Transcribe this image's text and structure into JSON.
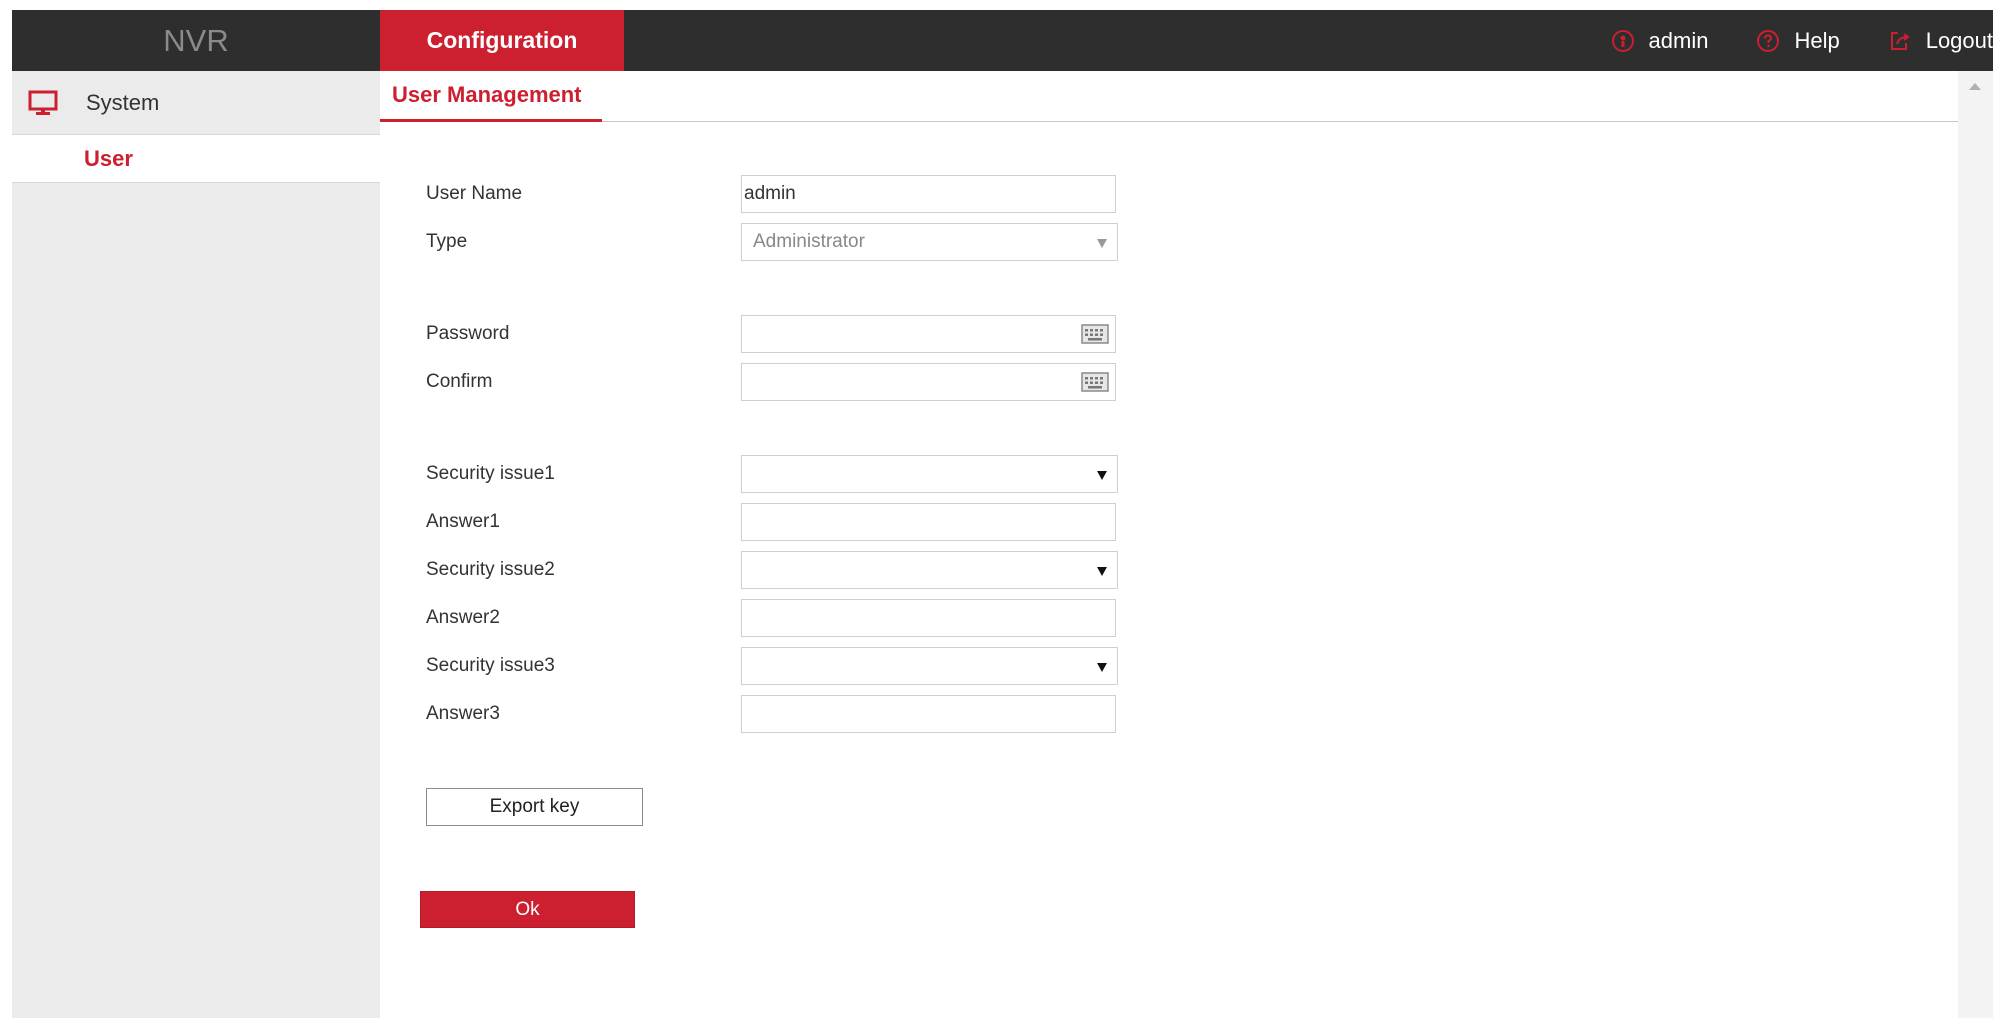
{
  "header": {
    "brand": "NVR",
    "active_tab": "Configuration",
    "user_label": "admin",
    "help_label": "Help",
    "logout_label": "Logout"
  },
  "sidebar": {
    "section_label": "System",
    "section_icon": "monitor-icon",
    "items": [
      {
        "label": "User"
      }
    ]
  },
  "main": {
    "tab_label": "User Management"
  },
  "form": {
    "user_name": {
      "label": "User Name",
      "value": "admin"
    },
    "type": {
      "label": "Type",
      "value": "Administrator"
    },
    "password": {
      "label": "Password",
      "value": ""
    },
    "confirm": {
      "label": "Confirm",
      "value": ""
    },
    "security1": {
      "label": "Security issue1",
      "value": ""
    },
    "answer1": {
      "label": "Answer1",
      "value": ""
    },
    "security2": {
      "label": "Security issue2",
      "value": ""
    },
    "answer2": {
      "label": "Answer2",
      "value": ""
    },
    "security3": {
      "label": "Security issue3",
      "value": ""
    },
    "answer3": {
      "label": "Answer3",
      "value": ""
    },
    "export_label": "Export key",
    "ok_label": "Ok"
  },
  "colors": {
    "accent": "#cc1f2f",
    "topbar": "#2e2e2e",
    "sidebar": "#ebebeb"
  }
}
